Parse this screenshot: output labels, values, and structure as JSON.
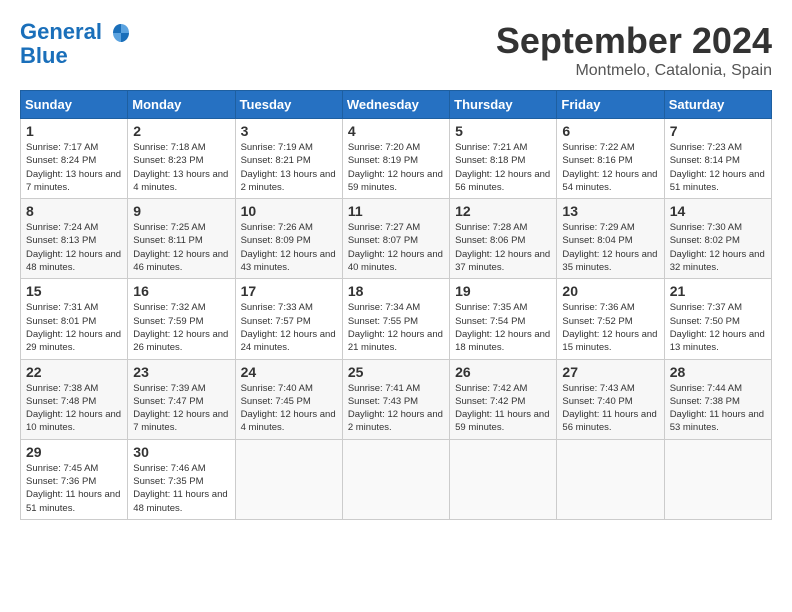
{
  "header": {
    "logo_line1": "General",
    "logo_line2": "Blue",
    "month_title": "September 2024",
    "location": "Montmelo, Catalonia, Spain"
  },
  "calendar": {
    "days_of_week": [
      "Sunday",
      "Monday",
      "Tuesday",
      "Wednesday",
      "Thursday",
      "Friday",
      "Saturday"
    ],
    "weeks": [
      [
        {
          "day": "1",
          "sunrise": "Sunrise: 7:17 AM",
          "sunset": "Sunset: 8:24 PM",
          "daylight": "Daylight: 13 hours and 7 minutes."
        },
        {
          "day": "2",
          "sunrise": "Sunrise: 7:18 AM",
          "sunset": "Sunset: 8:23 PM",
          "daylight": "Daylight: 13 hours and 4 minutes."
        },
        {
          "day": "3",
          "sunrise": "Sunrise: 7:19 AM",
          "sunset": "Sunset: 8:21 PM",
          "daylight": "Daylight: 13 hours and 2 minutes."
        },
        {
          "day": "4",
          "sunrise": "Sunrise: 7:20 AM",
          "sunset": "Sunset: 8:19 PM",
          "daylight": "Daylight: 12 hours and 59 minutes."
        },
        {
          "day": "5",
          "sunrise": "Sunrise: 7:21 AM",
          "sunset": "Sunset: 8:18 PM",
          "daylight": "Daylight: 12 hours and 56 minutes."
        },
        {
          "day": "6",
          "sunrise": "Sunrise: 7:22 AM",
          "sunset": "Sunset: 8:16 PM",
          "daylight": "Daylight: 12 hours and 54 minutes."
        },
        {
          "day": "7",
          "sunrise": "Sunrise: 7:23 AM",
          "sunset": "Sunset: 8:14 PM",
          "daylight": "Daylight: 12 hours and 51 minutes."
        }
      ],
      [
        {
          "day": "8",
          "sunrise": "Sunrise: 7:24 AM",
          "sunset": "Sunset: 8:13 PM",
          "daylight": "Daylight: 12 hours and 48 minutes."
        },
        {
          "day": "9",
          "sunrise": "Sunrise: 7:25 AM",
          "sunset": "Sunset: 8:11 PM",
          "daylight": "Daylight: 12 hours and 46 minutes."
        },
        {
          "day": "10",
          "sunrise": "Sunrise: 7:26 AM",
          "sunset": "Sunset: 8:09 PM",
          "daylight": "Daylight: 12 hours and 43 minutes."
        },
        {
          "day": "11",
          "sunrise": "Sunrise: 7:27 AM",
          "sunset": "Sunset: 8:07 PM",
          "daylight": "Daylight: 12 hours and 40 minutes."
        },
        {
          "day": "12",
          "sunrise": "Sunrise: 7:28 AM",
          "sunset": "Sunset: 8:06 PM",
          "daylight": "Daylight: 12 hours and 37 minutes."
        },
        {
          "day": "13",
          "sunrise": "Sunrise: 7:29 AM",
          "sunset": "Sunset: 8:04 PM",
          "daylight": "Daylight: 12 hours and 35 minutes."
        },
        {
          "day": "14",
          "sunrise": "Sunrise: 7:30 AM",
          "sunset": "Sunset: 8:02 PM",
          "daylight": "Daylight: 12 hours and 32 minutes."
        }
      ],
      [
        {
          "day": "15",
          "sunrise": "Sunrise: 7:31 AM",
          "sunset": "Sunset: 8:01 PM",
          "daylight": "Daylight: 12 hours and 29 minutes."
        },
        {
          "day": "16",
          "sunrise": "Sunrise: 7:32 AM",
          "sunset": "Sunset: 7:59 PM",
          "daylight": "Daylight: 12 hours and 26 minutes."
        },
        {
          "day": "17",
          "sunrise": "Sunrise: 7:33 AM",
          "sunset": "Sunset: 7:57 PM",
          "daylight": "Daylight: 12 hours and 24 minutes."
        },
        {
          "day": "18",
          "sunrise": "Sunrise: 7:34 AM",
          "sunset": "Sunset: 7:55 PM",
          "daylight": "Daylight: 12 hours and 21 minutes."
        },
        {
          "day": "19",
          "sunrise": "Sunrise: 7:35 AM",
          "sunset": "Sunset: 7:54 PM",
          "daylight": "Daylight: 12 hours and 18 minutes."
        },
        {
          "day": "20",
          "sunrise": "Sunrise: 7:36 AM",
          "sunset": "Sunset: 7:52 PM",
          "daylight": "Daylight: 12 hours and 15 minutes."
        },
        {
          "day": "21",
          "sunrise": "Sunrise: 7:37 AM",
          "sunset": "Sunset: 7:50 PM",
          "daylight": "Daylight: 12 hours and 13 minutes."
        }
      ],
      [
        {
          "day": "22",
          "sunrise": "Sunrise: 7:38 AM",
          "sunset": "Sunset: 7:48 PM",
          "daylight": "Daylight: 12 hours and 10 minutes."
        },
        {
          "day": "23",
          "sunrise": "Sunrise: 7:39 AM",
          "sunset": "Sunset: 7:47 PM",
          "daylight": "Daylight: 12 hours and 7 minutes."
        },
        {
          "day": "24",
          "sunrise": "Sunrise: 7:40 AM",
          "sunset": "Sunset: 7:45 PM",
          "daylight": "Daylight: 12 hours and 4 minutes."
        },
        {
          "day": "25",
          "sunrise": "Sunrise: 7:41 AM",
          "sunset": "Sunset: 7:43 PM",
          "daylight": "Daylight: 12 hours and 2 minutes."
        },
        {
          "day": "26",
          "sunrise": "Sunrise: 7:42 AM",
          "sunset": "Sunset: 7:42 PM",
          "daylight": "Daylight: 11 hours and 59 minutes."
        },
        {
          "day": "27",
          "sunrise": "Sunrise: 7:43 AM",
          "sunset": "Sunset: 7:40 PM",
          "daylight": "Daylight: 11 hours and 56 minutes."
        },
        {
          "day": "28",
          "sunrise": "Sunrise: 7:44 AM",
          "sunset": "Sunset: 7:38 PM",
          "daylight": "Daylight: 11 hours and 53 minutes."
        }
      ],
      [
        {
          "day": "29",
          "sunrise": "Sunrise: 7:45 AM",
          "sunset": "Sunset: 7:36 PM",
          "daylight": "Daylight: 11 hours and 51 minutes."
        },
        {
          "day": "30",
          "sunrise": "Sunrise: 7:46 AM",
          "sunset": "Sunset: 7:35 PM",
          "daylight": "Daylight: 11 hours and 48 minutes."
        },
        null,
        null,
        null,
        null,
        null
      ]
    ]
  }
}
